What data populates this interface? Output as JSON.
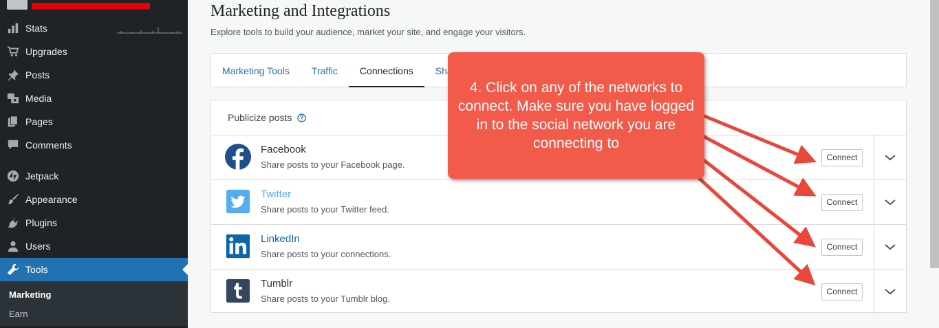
{
  "sidebar": {
    "items": [
      {
        "label": "Stats",
        "icon": "stats-icon"
      },
      {
        "label": "Upgrades",
        "icon": "cart-icon"
      },
      {
        "label": "Posts",
        "icon": "pin-icon"
      },
      {
        "label": "Media",
        "icon": "media-icon"
      },
      {
        "label": "Pages",
        "icon": "pages-icon"
      },
      {
        "label": "Comments",
        "icon": "comment-icon"
      },
      {
        "label": "Jetpack",
        "icon": "jetpack-icon"
      },
      {
        "label": "Appearance",
        "icon": "brush-icon"
      },
      {
        "label": "Plugins",
        "icon": "plugin-icon"
      },
      {
        "label": "Users",
        "icon": "user-icon"
      },
      {
        "label": "Tools",
        "icon": "wrench-icon"
      }
    ],
    "submenu": [
      {
        "label": "Marketing"
      },
      {
        "label": "Earn"
      }
    ]
  },
  "page": {
    "title": "Marketing and Integrations",
    "subtitle": "Explore tools to build your audience, market your site, and engage your visitors."
  },
  "tabs": [
    {
      "label": "Marketing Tools"
    },
    {
      "label": "Traffic"
    },
    {
      "label": "Connections"
    },
    {
      "label": "Sha"
    }
  ],
  "publicize": {
    "header": "Publicize posts",
    "services": [
      {
        "name": "Facebook",
        "description": "Share posts to your Facebook page.",
        "button": "Connect",
        "brand_color": "#3b5998"
      },
      {
        "name": "Twitter",
        "description": "Share posts to your Twitter feed.",
        "button": "Connect",
        "brand_color": "#55acee"
      },
      {
        "name": "LinkedIn",
        "description": "Share posts to your connections.",
        "button": "Connect",
        "brand_color": "#0077b5"
      },
      {
        "name": "Tumblr",
        "description": "Share posts to your Tumblr blog.",
        "button": "Connect",
        "brand_color": "#35465c"
      }
    ]
  },
  "callout": {
    "text": "4. Click on any of the networks to connect. Make sure you have logged in to the social network you are connecting to",
    "color": "#f25a4a"
  },
  "colors": {
    "sidebar_bg": "#1d2327",
    "active_bg": "#2271b1",
    "link": "#2271b1"
  }
}
